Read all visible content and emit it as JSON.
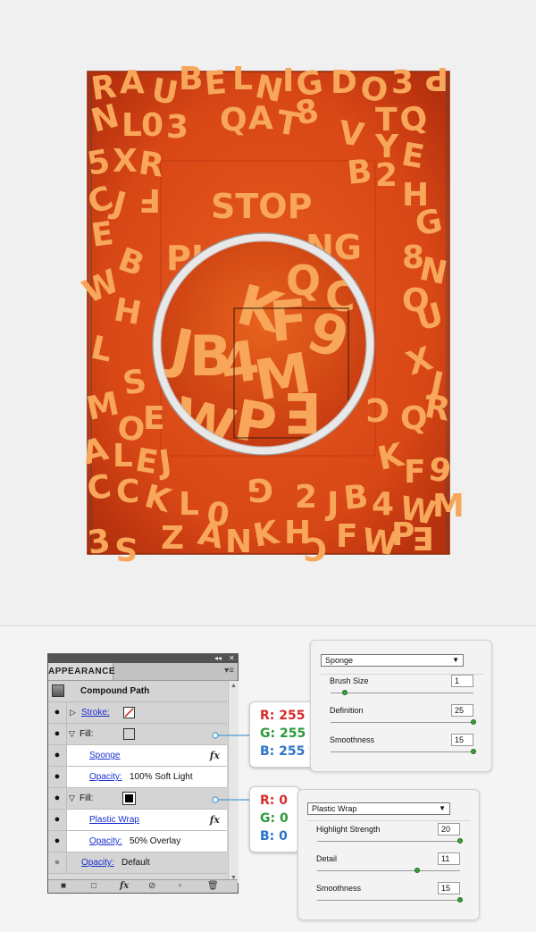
{
  "artwork": {
    "top_letters": "R A U B E L N I G D O 3 P",
    "word1": "STOP",
    "word2": "PLA",
    "word2b": "NG",
    "zoom_letters": [
      "K",
      "F",
      "9",
      "J",
      "B",
      "4",
      "W",
      "M"
    ]
  },
  "panel": {
    "title": "APPEARANCE",
    "collapse": "◂◂",
    "close": "✕",
    "menu": "▾≡",
    "object": "Compound Path",
    "stroke_label": "Stroke:",
    "fill1_label": "Fill:",
    "fill1_effect": "Sponge",
    "fill1_opacity_label": "Opacity:",
    "fill1_opacity_value": "100% Soft Light",
    "fill2_label": "Fill:",
    "fill2_effect": "Plastic Wrap",
    "fill2_opacity_label": "Opacity:",
    "fill2_opacity_value": "50% Overlay",
    "opacity_label": "Opacity:",
    "opacity_value": "Default",
    "fx": "fx",
    "fill1_color": "#ffffff",
    "fill2_color": "#000000"
  },
  "callout_white": {
    "r": "R: 255",
    "g": "G: 255",
    "b": "B: 255"
  },
  "callout_black": {
    "r": "R: 0",
    "g": "G: 0",
    "b": "B: 0"
  },
  "sponge": {
    "filter": "Sponge",
    "brush_size_label": "Brush Size",
    "brush_size_value": "1",
    "brush_size_level": 0.1,
    "definition_label": "Definition",
    "definition_value": "25",
    "definition_level": 1.0,
    "smoothness_label": "Smoothness",
    "smoothness_value": "15",
    "smoothness_level": 1.0
  },
  "plastic": {
    "filter": "Plastic Wrap",
    "highlight_label": "Highlight Strength",
    "highlight_value": "20",
    "highlight_level": 1.0,
    "detail_label": "Detail",
    "detail_value": "11",
    "detail_level": 0.7,
    "smoothness_label": "Smoothness",
    "smoothness_value": "15",
    "smoothness_level": 1.0
  },
  "colors": {
    "orange_bg": "#d84716",
    "letter": "#f7a65a",
    "link": "#1a2fd0",
    "callout_r": "#d62b2b",
    "callout_g": "#2a9a3c",
    "callout_b": "#2b74c7"
  }
}
